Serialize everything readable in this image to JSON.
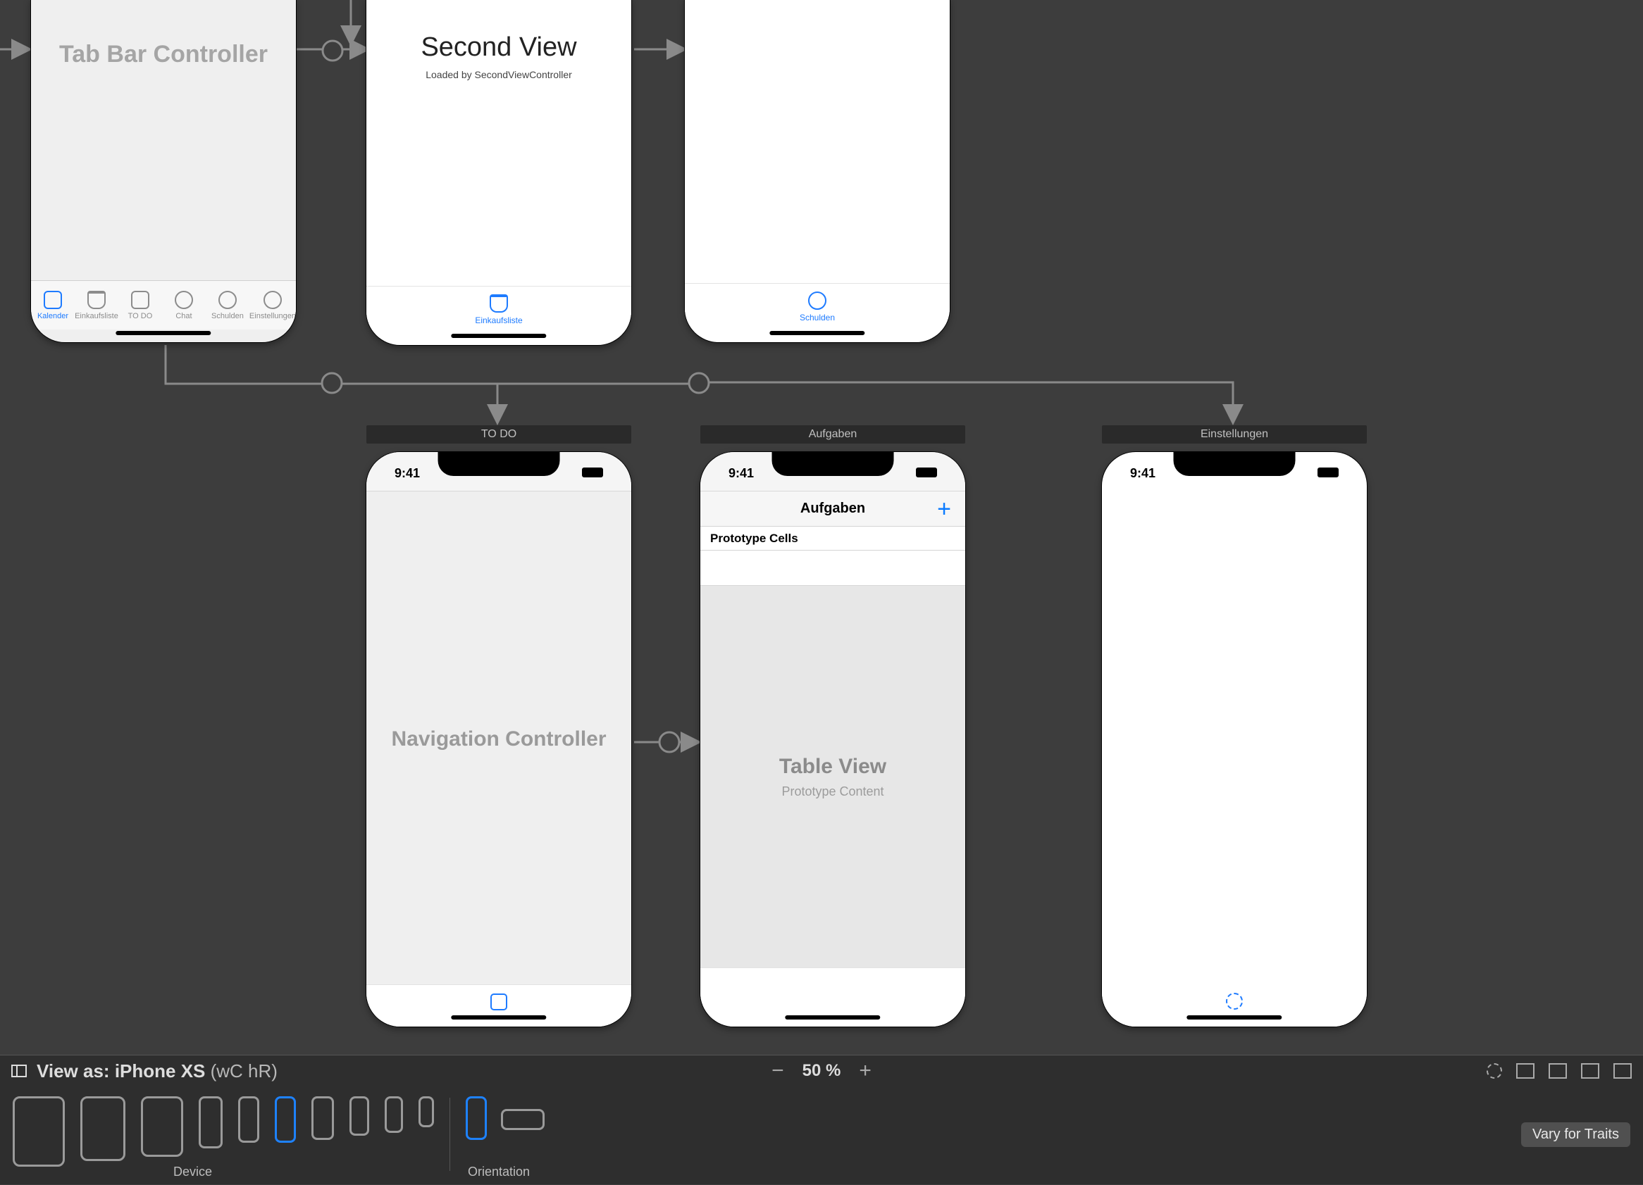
{
  "scenes": {
    "tabbar_controller": {
      "label": "Tab Bar Controller",
      "tabs": [
        {
          "label": "Kalender"
        },
        {
          "label": "Einkaufsliste"
        },
        {
          "label": "TO DO"
        },
        {
          "label": "Chat"
        },
        {
          "label": "Schulden"
        },
        {
          "label": "Einstellungen"
        }
      ]
    },
    "second_view": {
      "title": "Second View",
      "subtitle": "Loaded by SecondViewController",
      "tab_label": "Einkaufsliste"
    },
    "schulden_view": {
      "tab_label": "Schulden"
    },
    "todo_nav": {
      "scene_title": "TO DO",
      "status_time": "9:41",
      "label": "Navigation Controller"
    },
    "aufgaben": {
      "scene_title": "Aufgaben",
      "status_time": "9:41",
      "nav_title": "Aufgaben",
      "add_glyph": "+",
      "proto_header": "Prototype Cells",
      "tv_title": "Table View",
      "tv_sub": "Prototype Content"
    },
    "einstellungen": {
      "scene_title": "Einstellungen",
      "status_time": "9:41"
    }
  },
  "device_bar": {
    "viewas_prefix": "View as: ",
    "viewas_device": "iPhone XS",
    "viewas_traits": " (wC hR)",
    "zoom_label": "50 %",
    "device_label": "Device",
    "orientation_label": "Orientation",
    "vary_label": "Vary for Traits"
  }
}
